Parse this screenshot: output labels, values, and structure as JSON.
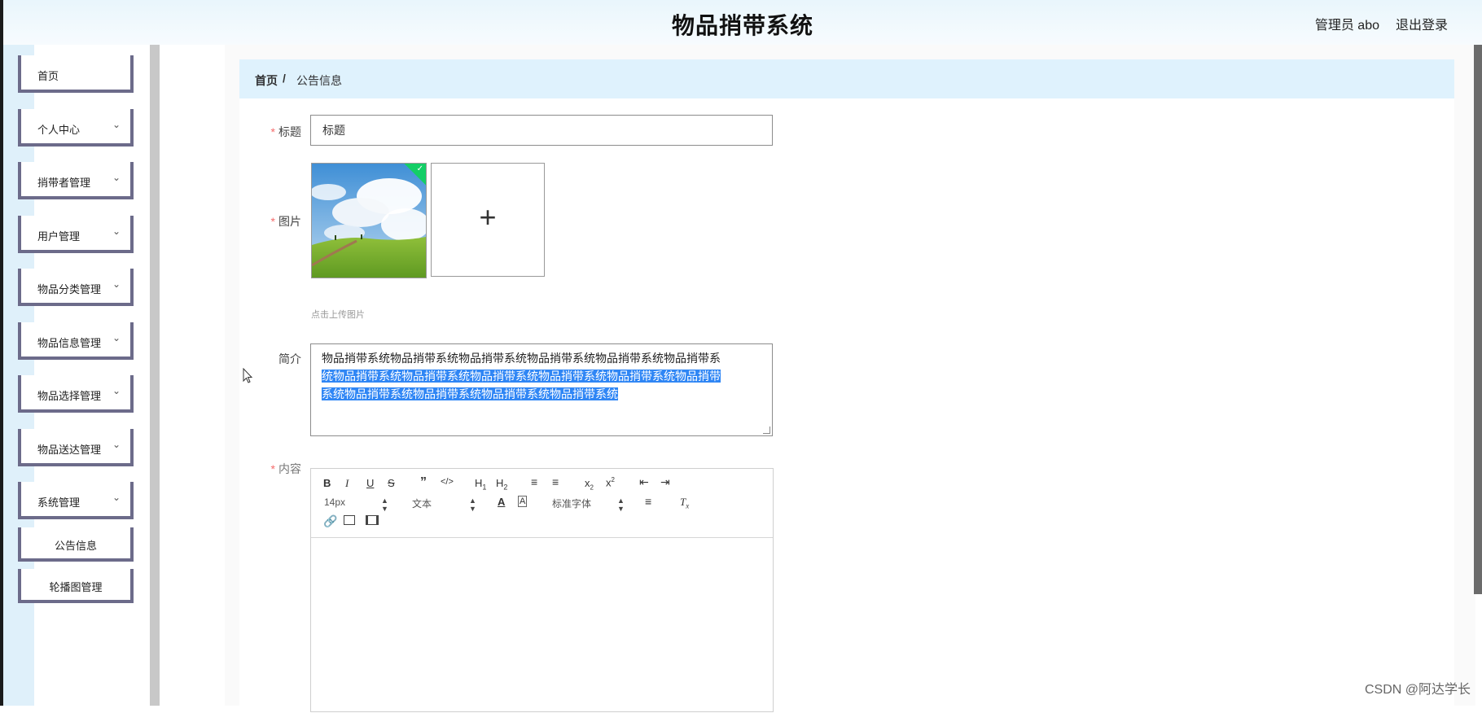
{
  "header": {
    "title": "物品捎带系统",
    "user": "管理员 abo",
    "logout": "退出登录"
  },
  "sidebar": {
    "items": [
      {
        "label": "首页",
        "has_children": false
      },
      {
        "label": "个人中心",
        "has_children": true
      },
      {
        "label": "捎带者管理",
        "has_children": true
      },
      {
        "label": "用户管理",
        "has_children": true
      },
      {
        "label": "物品分类管理",
        "has_children": true
      },
      {
        "label": "物品信息管理",
        "has_children": true
      },
      {
        "label": "物品选择管理",
        "has_children": true
      },
      {
        "label": "物品送达管理",
        "has_children": true
      },
      {
        "label": "系统管理",
        "has_children": true
      }
    ],
    "sub_items": [
      {
        "label": "公告信息"
      },
      {
        "label": "轮播图管理"
      }
    ]
  },
  "breadcrumb": {
    "home": "首页",
    "separator": "/",
    "current": "公告信息"
  },
  "form": {
    "title_label": "标题",
    "title_value": "标题",
    "image_label": "图片",
    "upload_hint": "点击上传图片",
    "summary_label": "简介",
    "summary_line1": "物品捎带系统物品捎带系统物品捎带系统物品捎带系统物品捎带系统物品捎带系",
    "summary_line2": "统物品捎带系统物品捎带系统物品捎带系统物品捎带系统物品捎带系统物品捎带",
    "summary_line3": "系统物品捎带系统物品捎带系统物品捎带系统物品捎带系统",
    "content_label": "内容"
  },
  "editor": {
    "font_size": "14px",
    "text_type": "文本",
    "font_family": "标准字体"
  },
  "watermark": "CSDN @阿达学长"
}
